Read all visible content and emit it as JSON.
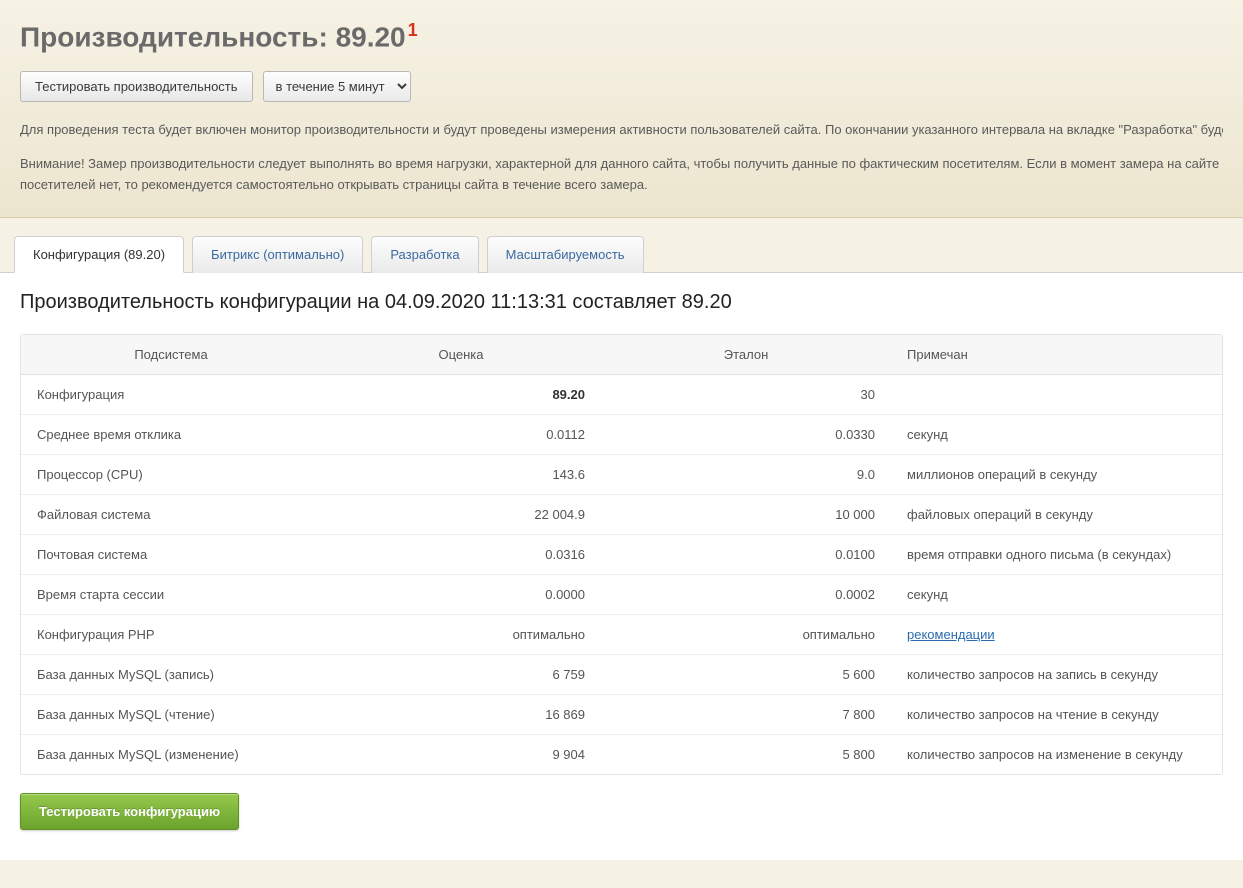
{
  "header": {
    "title_prefix": "Производительность: ",
    "title_value": "89.20",
    "title_sup": "1",
    "test_button": "Тестировать производительность",
    "duration_select": "в течение 5 минут",
    "info1": "Для проведения теста будет включен монитор производительности и будут проведены измерения активности пользователей сайта. По окончании указанного интервала на вкладке \"Разработка\" будет вы",
    "info2": "Внимание! Замер производительности следует выполнять во время нагрузки, характерной для данного сайта, чтобы получить данные по фактическим посетителям. Если в момент замера на сайте посетителей нет, то рекомендуется самостоятельно открывать страницы сайта в течение всего замера."
  },
  "tabs": [
    {
      "label": "Конфигурация (89.20)",
      "active": true
    },
    {
      "label": "Битрикс (оптимально)",
      "active": false
    },
    {
      "label": "Разработка",
      "active": false
    },
    {
      "label": "Масштабируемость",
      "active": false
    }
  ],
  "section_title": "Производительность конфигурации на 04.09.2020 11:13:31 составляет 89.20",
  "columns": {
    "subsystem": "Подсистема",
    "score": "Оценка",
    "etalon": "Эталон",
    "note": "Примечан"
  },
  "rows": [
    {
      "name": "Конфигурация",
      "score": "89.20",
      "score_bold": true,
      "etalon": "30",
      "note": ""
    },
    {
      "name": "Среднее время отклика",
      "score": "0.0112",
      "score_bold": false,
      "etalon": "0.0330",
      "note": "секунд"
    },
    {
      "name": "Процессор (CPU)",
      "score": "143.6",
      "score_bold": false,
      "etalon": "9.0",
      "note": "миллионов операций в секунду"
    },
    {
      "name": "Файловая система",
      "score": "22 004.9",
      "score_bold": false,
      "etalon": "10 000",
      "note": "файловых операций в секунду"
    },
    {
      "name": "Почтовая система",
      "score": "0.0316",
      "score_bold": false,
      "etalon": "0.0100",
      "note": "время отправки одного письма (в секундах)"
    },
    {
      "name": "Время старта сессии",
      "score": "0.0000",
      "score_bold": false,
      "etalon": "0.0002",
      "note": "секунд"
    },
    {
      "name": "Конфигурация PHP",
      "score": "оптимально",
      "score_bold": false,
      "etalon": "оптимально",
      "note": "рекомендации",
      "note_link": true
    },
    {
      "name": "База данных MySQL (запись)",
      "score": "6 759",
      "score_bold": false,
      "etalon": "5 600",
      "note": "количество запросов на запись в секунду"
    },
    {
      "name": "База данных MySQL (чтение)",
      "score": "16 869",
      "score_bold": false,
      "etalon": "7 800",
      "note": "количество запросов на чтение в секунду"
    },
    {
      "name": "База данных MySQL (изменение)",
      "score": "9 904",
      "score_bold": false,
      "etalon": "5 800",
      "note": "количество запросов на изменение в секунду"
    }
  ],
  "action_button": "Тестировать конфигурацию"
}
